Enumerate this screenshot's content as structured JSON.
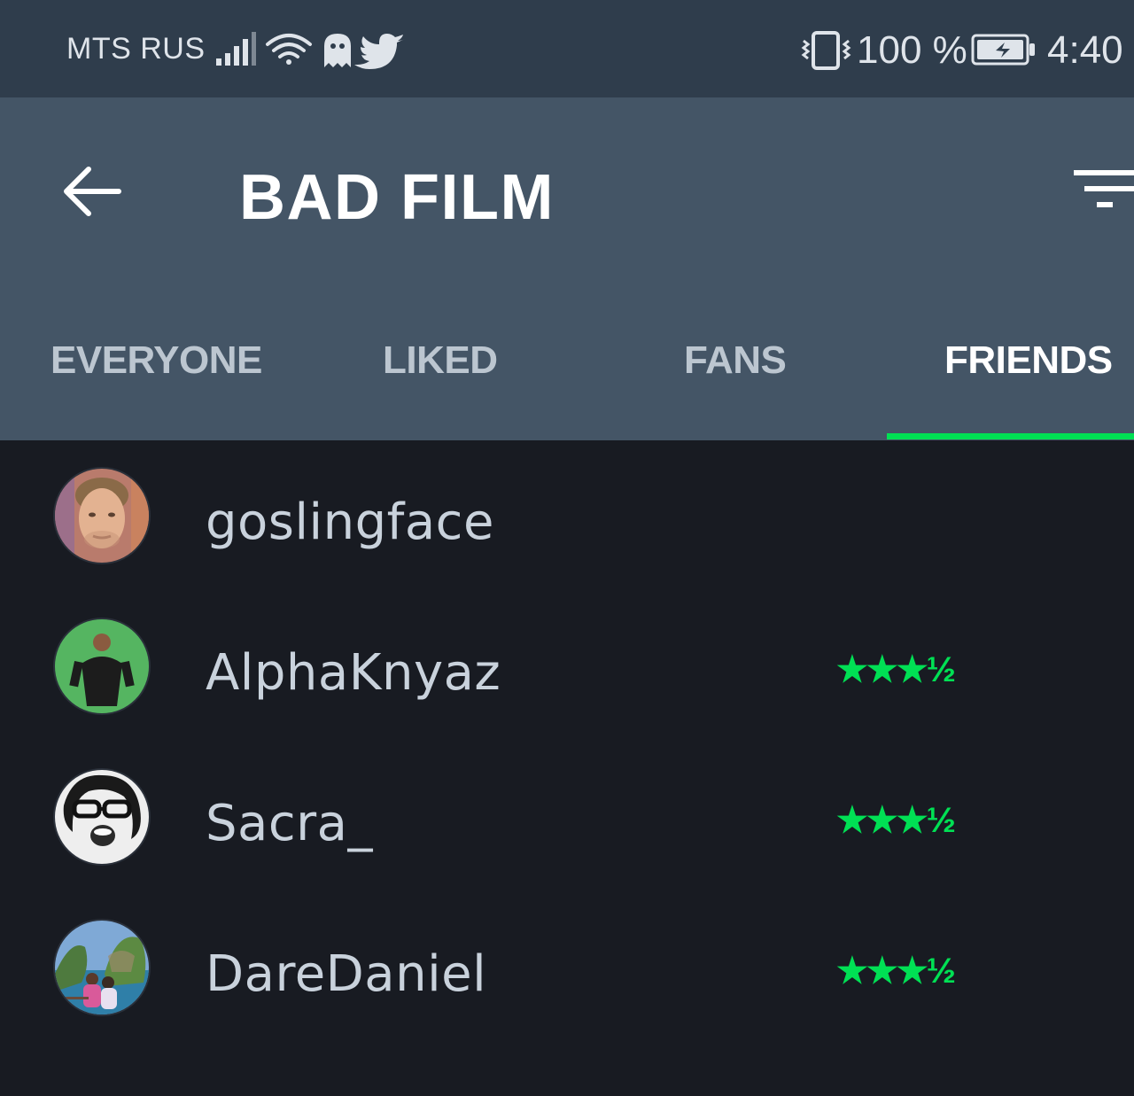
{
  "status_bar": {
    "carrier": "MTS RUS",
    "battery": "100 %",
    "time": "4:40",
    "icons": [
      "signal-icon",
      "wifi-icon",
      "ghost-icon",
      "twitter-icon",
      "vibrate-icon",
      "battery-charging-icon"
    ]
  },
  "app_bar": {
    "title": "BAD FILM",
    "back_icon": "arrow-left-icon",
    "filter_icon": "filter-icon"
  },
  "tabs": [
    {
      "label": "EVERYONE",
      "active": false
    },
    {
      "label": "LIKED",
      "active": false
    },
    {
      "label": "FANS",
      "active": false
    },
    {
      "label": "FRIENDS",
      "active": true
    }
  ],
  "friends": [
    {
      "username": "goslingface",
      "rating": ""
    },
    {
      "username": "AlphaKnyaz",
      "rating": "★★★½"
    },
    {
      "username": "Sacra_",
      "rating": "★★★½"
    },
    {
      "username": "DareDaniel",
      "rating": "★★★½"
    }
  ],
  "colors": {
    "accent": "#00e054",
    "status_bar_bg": "#2f3d4c",
    "app_bar_bg": "#445566",
    "list_bg": "#181b22"
  }
}
